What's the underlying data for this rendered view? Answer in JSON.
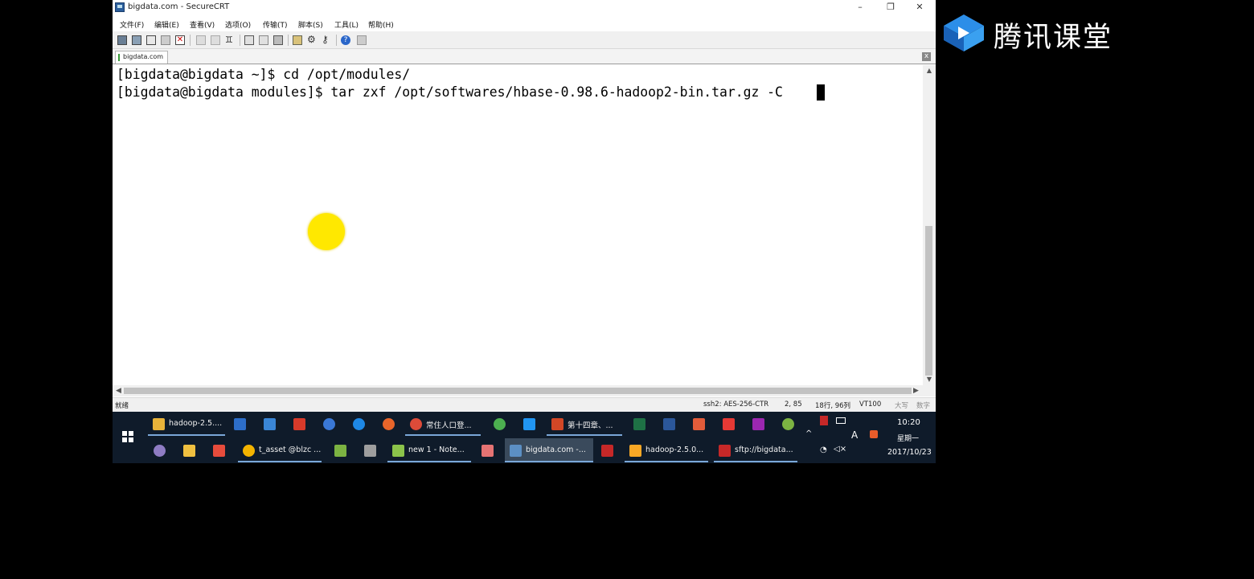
{
  "window": {
    "title": "bigdata.com - SecureCRT",
    "minimize": "–",
    "restore": "❐",
    "close": "✕"
  },
  "menu": [
    "文件(F)",
    "编辑(E)",
    "查看(V)",
    "选项(O)",
    "传输(T)",
    "脚本(S)",
    "工具(L)",
    "帮助(H)"
  ],
  "tab": {
    "label": "bigdata.com",
    "close": "x"
  },
  "terminal": {
    "lines": [
      "[bigdata@bigdata ~]$ cd /opt/modules/",
      "[bigdata@bigdata modules]$ tar zxf /opt/softwares/hbase-0.98.6-hadoop2-bin.tar.gz -C"
    ]
  },
  "statusbar": {
    "ready": "就绪",
    "encryption": "ssh2: AES-256-CTR",
    "cursor_pos": "2, 85",
    "rows_cols": "18行, 96列",
    "terminal_type": "VT100",
    "caps": "大写",
    "num": "数字"
  },
  "taskbar": {
    "row1": [
      {
        "label": "hadoop-2.5....",
        "color": "#e8b33a"
      },
      {
        "label": "",
        "color": "#2d6ec9"
      },
      {
        "label": "",
        "color": "#3a86d6"
      },
      {
        "label": "",
        "color": "#d83a2a"
      },
      {
        "label": "",
        "color": "#3a78d6"
      },
      {
        "label": "",
        "color": "#1e88e5"
      },
      {
        "label": "",
        "color": "#e8652a"
      },
      {
        "label": "常住人口登...",
        "color": "#dd4b39"
      },
      {
        "label": "",
        "color": "#4caf50"
      },
      {
        "label": "",
        "color": "#2196f3"
      },
      {
        "label": "第十四章、...",
        "color": "#d24726"
      },
      {
        "label": "",
        "color": "#1e7145"
      },
      {
        "label": "",
        "color": "#2b579a"
      },
      {
        "label": "",
        "color": "#e25c3a"
      },
      {
        "label": "",
        "color": "#e53935"
      },
      {
        "label": "",
        "color": "#9c27b0"
      },
      {
        "label": "",
        "color": "#7cb342"
      }
    ],
    "row2": [
      {
        "label": "",
        "color": "#8e7cc3"
      },
      {
        "label": "",
        "color": "#f0c040"
      },
      {
        "label": "",
        "color": "#e74c3c"
      },
      {
        "label": "t_asset @blzc ...",
        "color": "#f4b400"
      },
      {
        "label": "",
        "color": "#7cb342"
      },
      {
        "label": "",
        "color": "#9e9e9e"
      },
      {
        "label": "new  1 - Note...",
        "color": "#8bc34a"
      },
      {
        "label": "",
        "color": "#e57373"
      },
      {
        "label": "bigdata.com -...",
        "color": "#5c8fc4"
      },
      {
        "label": "",
        "color": "#c62828"
      },
      {
        "label": "hadoop-2.5.0...",
        "color": "#f9a825"
      },
      {
        "label": "sftp://bigdata...",
        "color": "#c62828"
      }
    ],
    "tray": {
      "chevron": "^",
      "ime": "A",
      "clock_time": "10:20",
      "clock_day": "星期一",
      "clock_date": "2017/10/23"
    }
  },
  "watermark": {
    "text": "腾讯课堂"
  },
  "colors": {
    "accent": "#7aa7d8",
    "pointer": "#ffe800",
    "taskbar": "#0f1b2a"
  }
}
